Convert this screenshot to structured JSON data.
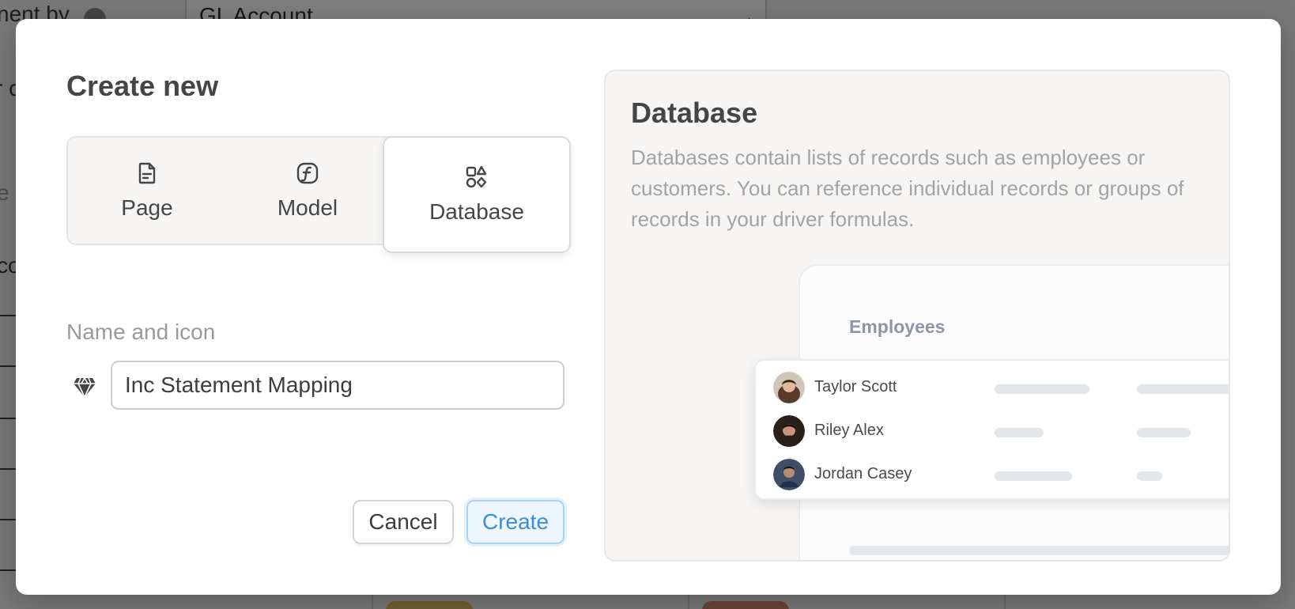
{
  "background": {
    "label": "nent by",
    "field_text": "GL Account",
    "frag_a": "r c",
    "frag_b": "e",
    "frag_c": "co"
  },
  "modal": {
    "title": "Create new",
    "types": [
      {
        "label": "Page",
        "icon": "page-icon"
      },
      {
        "label": "Model",
        "icon": "function-icon"
      },
      {
        "label": "Database",
        "icon": "shapes-icon",
        "selected": true
      }
    ],
    "name_label": "Name and icon",
    "name_icon": "diamond-icon",
    "name_value": "Inc Statement Mapping",
    "cancel_label": "Cancel",
    "create_label": "Create"
  },
  "preview": {
    "title": "Database",
    "description": "Databases contain lists of records such as employees or customers. You can reference individual records or groups of records in your driver formulas.",
    "table_title": "Employees",
    "employees": [
      {
        "name": "Taylor Scott"
      },
      {
        "name": "Riley Alex"
      },
      {
        "name": "Jordan Casey"
      }
    ]
  },
  "colors": {
    "accent": "#3a8fd8",
    "overlay": "rgba(0,0,0,0.5)"
  }
}
